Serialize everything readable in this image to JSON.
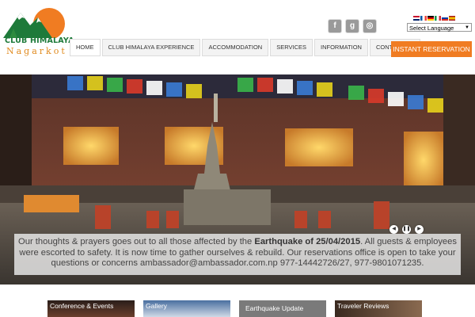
{
  "logo": {
    "name": "CLUB HIMALAYA",
    "sub": "Nagarkot"
  },
  "nav": [
    {
      "label": "HOME"
    },
    {
      "label": "CLUB HIMALAYA EXPERIENCE"
    },
    {
      "label": "ACCOMMODATION"
    },
    {
      "label": "SERVICES"
    },
    {
      "label": "INFORMATION"
    },
    {
      "label": "CONTACT US"
    }
  ],
  "social": {
    "facebook": {
      "icon": "facebook-icon",
      "glyph": "f"
    },
    "google": {
      "icon": "google-plus-icon",
      "glyph": "g"
    },
    "instagram": {
      "icon": "instagram-icon",
      "glyph": "◎"
    }
  },
  "language": {
    "value": "Select Language"
  },
  "reserve": {
    "label": "INSTANT RESERVATION"
  },
  "hero": {
    "caption_pre": "Our thoughts & prayers goes out to all those affected by the ",
    "caption_bold": "Earthquake of 25/04/2015",
    "caption_post": ". All guests & employees were escorted to safety.  It is now time to gather ourselves & rebuild. Our reservations office is open to take your questions or concerns ambassador@ambassador.com.np 977-14442726/27, 977-9801071235.",
    "controls": {
      "prev": "◀",
      "pause": "❚❚",
      "next": "▶"
    }
  },
  "tiles": [
    {
      "label": "Conference & Events"
    },
    {
      "label": "Gallery"
    },
    {
      "label": "Earthquake Update"
    },
    {
      "label": "Traveler Reviews"
    }
  ],
  "colors": {
    "accent": "#f07c22",
    "brand_green": "#1e7a3a"
  }
}
